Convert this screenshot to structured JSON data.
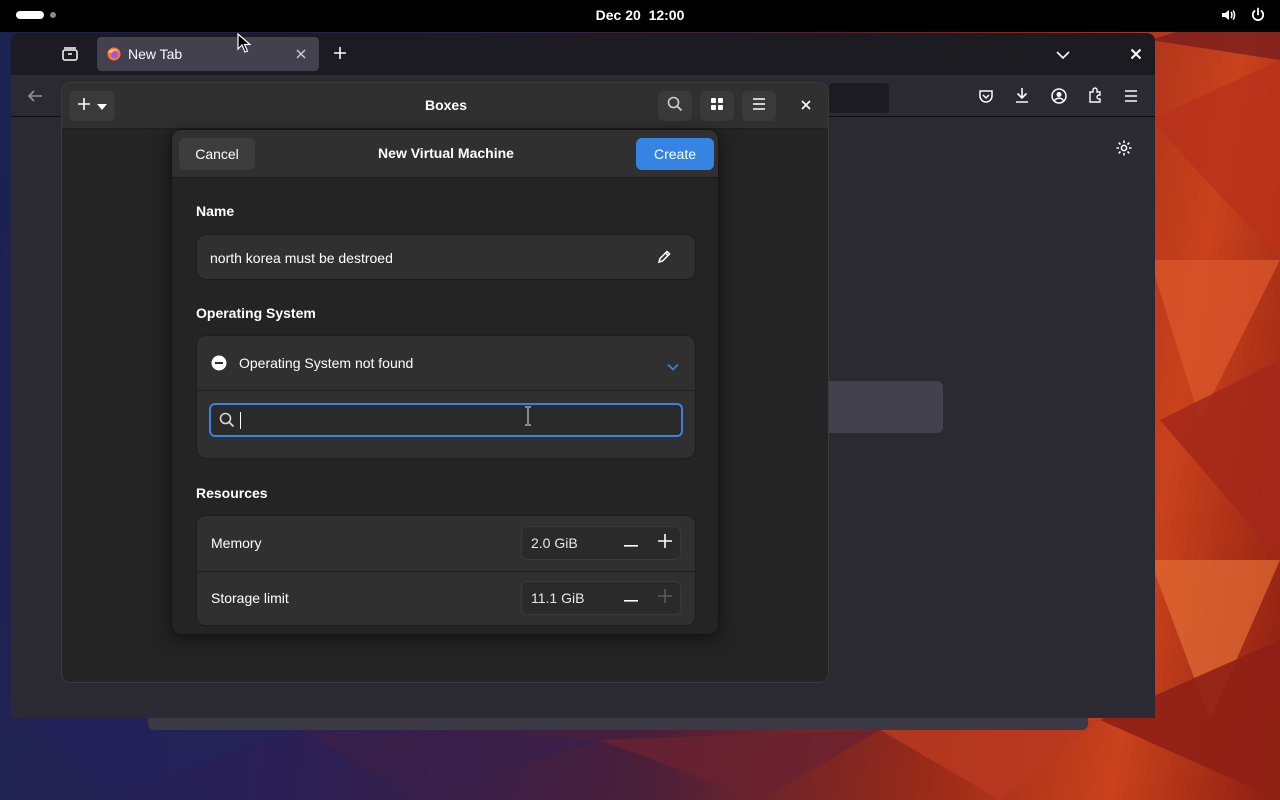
{
  "topbar": {
    "clock_date": "Dec 20",
    "clock_time": "12:00"
  },
  "browser": {
    "tab_label": "New Tab"
  },
  "boxes": {
    "title": "Boxes"
  },
  "dialog": {
    "title": "New Virtual Machine",
    "cancel_label": "Cancel",
    "create_label": "Create",
    "name_section_label": "Name",
    "name_value": "north korea must be destroed",
    "os_section_label": "Operating System",
    "os_status": "Operating System not found",
    "os_search_value": "",
    "resources_section_label": "Resources",
    "memory_label": "Memory",
    "memory_value": "2.0 GiB",
    "storage_label": "Storage limit",
    "storage_value": "11.1 GiB"
  },
  "colors": {
    "accent": "#3584e4",
    "window_bg": "#242424",
    "card_bg": "#303030"
  }
}
